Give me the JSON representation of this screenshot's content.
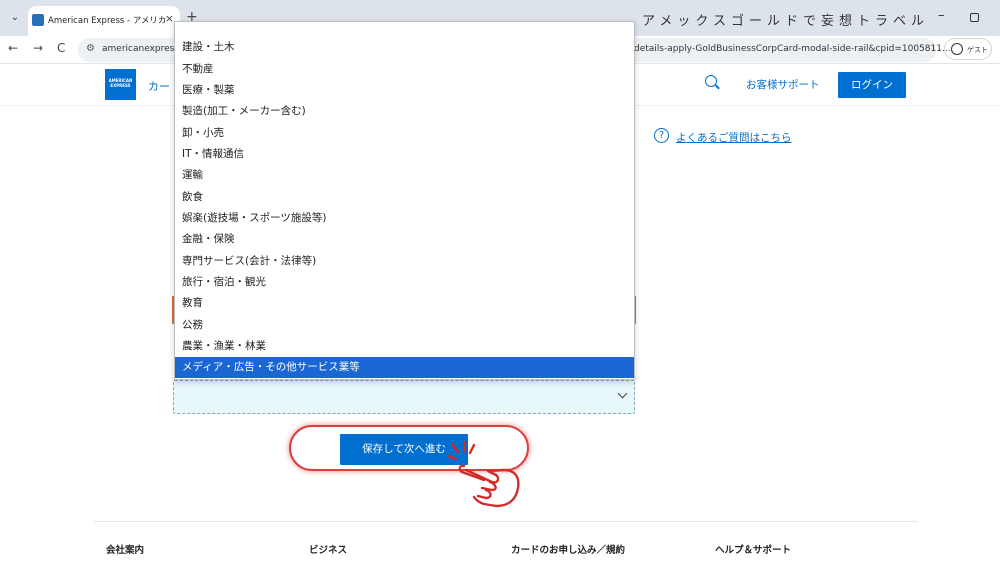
{
  "browser": {
    "tab_title": "American Express - アメリカン･エ",
    "tab_close": "×",
    "new_tab": "+",
    "window_title": "アメックスゴールドで妄想トラベル",
    "minimize": "–",
    "url_left": "americanexpress.",
    "url_right": "details-apply-GoldBusinessCorpCard-modal-side-rail&cpid=1005811...",
    "back": "←",
    "forward": "→",
    "reload": "C",
    "guest_label": "ゲスト"
  },
  "header": {
    "logo_text": "AMERICAN EXPRESS",
    "nav_card": "カー",
    "support_link": "お客様サポート",
    "login_button": "ログイン"
  },
  "faq": {
    "icon": "?",
    "label": "よくあるご質問はこちら"
  },
  "dropdown": {
    "options": [
      "建設・土木",
      "不動産",
      "医療・製薬",
      "製造(加工・メーカー含む)",
      "卸・小売",
      "IT・情報通信",
      "運輸",
      "飲食",
      "娯楽(遊技場・スポーツ施設等)",
      "金融・保険",
      "専門サービス(会計・法律等)",
      "旅行・宿泊・観光",
      "教育",
      "公務",
      "農業・漁業・林業",
      "メディア・広告・その他サービス業等"
    ],
    "selected_index": 15
  },
  "save_button": "保存して次へ進む",
  "footer": {
    "columns": [
      "会社案内",
      "ビジネス",
      "カードのお申し込み／規約",
      "ヘルプ＆サポート"
    ]
  },
  "colors": {
    "brand_blue": "#006fcf",
    "selected_option": "#1a66d2",
    "highlight_red": "#e13c3c"
  }
}
